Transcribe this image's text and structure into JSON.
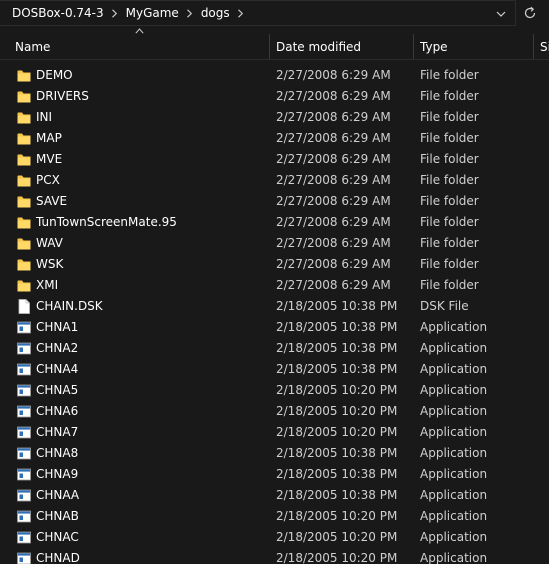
{
  "breadcrumb": [
    "DOSBox-0.74-3",
    "MyGame",
    "dogs"
  ],
  "columns": {
    "name": "Name",
    "date": "Date modified",
    "type": "Type",
    "size": "Si"
  },
  "colors": {
    "background": "#191919",
    "folder": "#f5c64a",
    "app_icon_blue": "#2f6fb3"
  },
  "rows": [
    {
      "icon": "folder-icon",
      "name": "DEMO",
      "date": "2/27/2008 6:29 AM",
      "type": "File folder"
    },
    {
      "icon": "folder-icon",
      "name": "DRIVERS",
      "date": "2/27/2008 6:29 AM",
      "type": "File folder"
    },
    {
      "icon": "folder-icon",
      "name": "INI",
      "date": "2/27/2008 6:29 AM",
      "type": "File folder"
    },
    {
      "icon": "folder-icon",
      "name": "MAP",
      "date": "2/27/2008 6:29 AM",
      "type": "File folder"
    },
    {
      "icon": "folder-icon",
      "name": "MVE",
      "date": "2/27/2008 6:29 AM",
      "type": "File folder"
    },
    {
      "icon": "folder-icon",
      "name": "PCX",
      "date": "2/27/2008 6:29 AM",
      "type": "File folder"
    },
    {
      "icon": "folder-icon",
      "name": "SAVE",
      "date": "2/27/2008 6:29 AM",
      "type": "File folder"
    },
    {
      "icon": "folder-icon",
      "name": "TunTownScreenMate.95",
      "date": "2/27/2008 6:29 AM",
      "type": "File folder"
    },
    {
      "icon": "folder-icon",
      "name": "WAV",
      "date": "2/27/2008 6:29 AM",
      "type": "File folder"
    },
    {
      "icon": "folder-icon",
      "name": "WSK",
      "date": "2/27/2008 6:29 AM",
      "type": "File folder"
    },
    {
      "icon": "folder-icon",
      "name": "XMI",
      "date": "2/27/2008 6:29 AM",
      "type": "File folder"
    },
    {
      "icon": "file-icon",
      "name": "CHAIN.DSK",
      "date": "2/18/2005 10:38 PM",
      "type": "DSK File"
    },
    {
      "icon": "application-icon",
      "name": "CHNA1",
      "date": "2/18/2005 10:38 PM",
      "type": "Application"
    },
    {
      "icon": "application-icon",
      "name": "CHNA2",
      "date": "2/18/2005 10:38 PM",
      "type": "Application"
    },
    {
      "icon": "application-icon",
      "name": "CHNA4",
      "date": "2/18/2005 10:38 PM",
      "type": "Application"
    },
    {
      "icon": "application-icon",
      "name": "CHNA5",
      "date": "2/18/2005 10:20 PM",
      "type": "Application"
    },
    {
      "icon": "application-icon",
      "name": "CHNA6",
      "date": "2/18/2005 10:20 PM",
      "type": "Application"
    },
    {
      "icon": "application-icon",
      "name": "CHNA7",
      "date": "2/18/2005 10:20 PM",
      "type": "Application"
    },
    {
      "icon": "application-icon",
      "name": "CHNA8",
      "date": "2/18/2005 10:38 PM",
      "type": "Application"
    },
    {
      "icon": "application-icon",
      "name": "CHNA9",
      "date": "2/18/2005 10:38 PM",
      "type": "Application"
    },
    {
      "icon": "application-icon",
      "name": "CHNAA",
      "date": "2/18/2005 10:38 PM",
      "type": "Application"
    },
    {
      "icon": "application-icon",
      "name": "CHNAB",
      "date": "2/18/2005 10:20 PM",
      "type": "Application"
    },
    {
      "icon": "application-icon",
      "name": "CHNAC",
      "date": "2/18/2005 10:20 PM",
      "type": "Application"
    },
    {
      "icon": "application-icon",
      "name": "CHNAD",
      "date": "2/18/2005 10:20 PM",
      "type": "Application"
    }
  ]
}
